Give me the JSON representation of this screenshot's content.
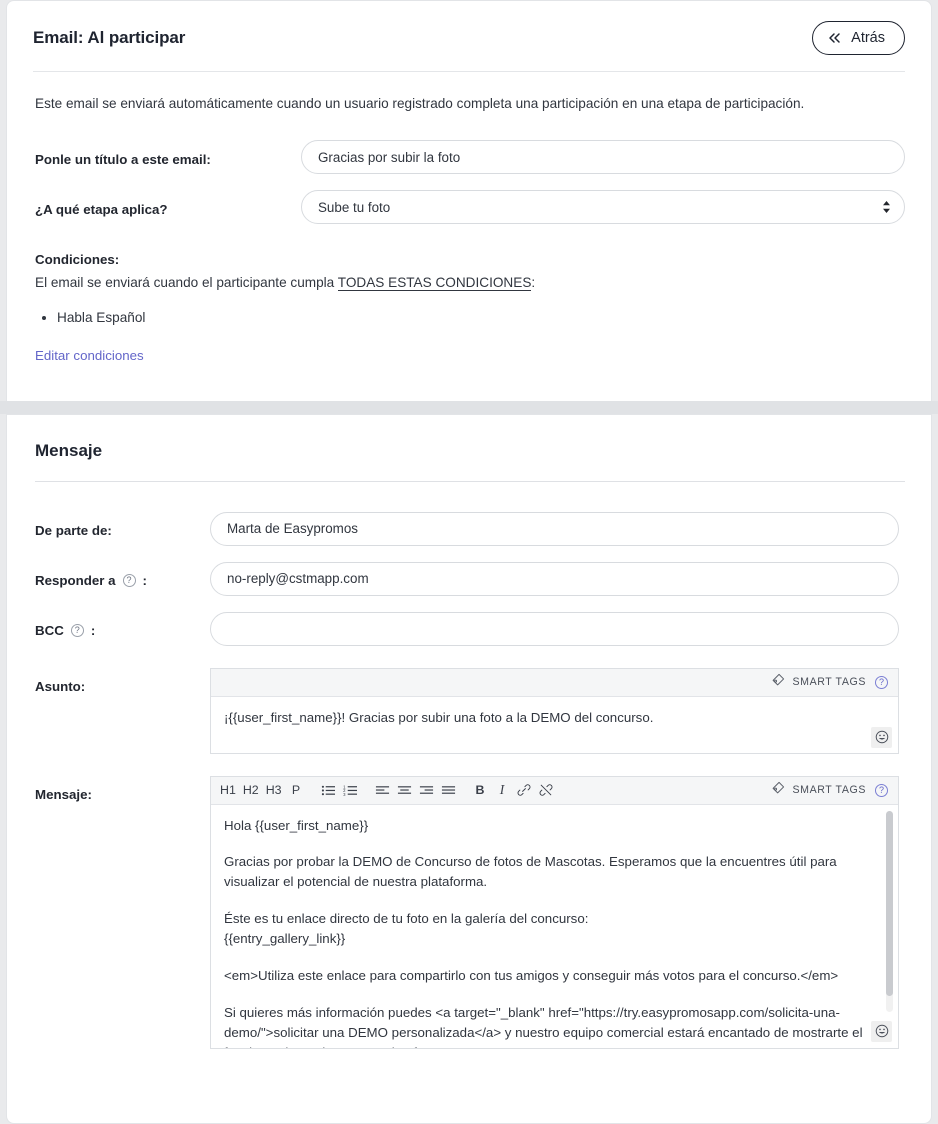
{
  "header": {
    "title": "Email: Al participar",
    "back_label": "Atrás",
    "back_icon": "double-chevron-left-icon"
  },
  "intro": "Este email se enviará automáticamente cuando un usuario registrado completa una participación en una etapa de participación.",
  "form": {
    "title_field": {
      "label": "Ponle un título a este email:",
      "value": "Gracias por subir la foto"
    },
    "stage_field": {
      "label": "¿A qué etapa aplica?",
      "value": "Sube tu foto"
    }
  },
  "conditions": {
    "heading": "Condiciones:",
    "sentence_prefix": "El email se enviará cuando el participante cumpla ",
    "sentence_emphasis": "TODAS ESTAS CONDICIONES",
    "sentence_suffix": ":",
    "items": [
      "Habla Español"
    ],
    "edit_link": "Editar condiciones"
  },
  "message": {
    "section_title": "Mensaje",
    "from": {
      "label": "De parte de:",
      "value": "Marta de Easypromos"
    },
    "reply_to": {
      "label": "Responder a",
      "suffix": ":",
      "value": "no-reply@cstmapp.com",
      "help_icon": "question-circle-icon"
    },
    "bcc": {
      "label": "BCC",
      "suffix": ":",
      "value": "",
      "placeholder": "",
      "help_icon": "question-circle-icon"
    },
    "subject": {
      "label": "Asunto:",
      "smart_tags_label": "SMART TAGS",
      "smart_tags_icon": "tag-icon",
      "help_icon": "question-circle-icon",
      "emoji_icon": "emoji-smile-icon",
      "value": "¡{{user_first_name}}! Gracias por subir una foto a la DEMO del concurso."
    },
    "body": {
      "label": "Mensaje:",
      "smart_tags_label": "SMART TAGS",
      "smart_tags_icon": "tag-icon",
      "help_icon": "question-circle-icon",
      "emoji_icon": "emoji-smile-icon",
      "toolbar": [
        {
          "name": "h1",
          "label": "H1",
          "icon": "heading-1-icon"
        },
        {
          "name": "h2",
          "label": "H2",
          "icon": "heading-2-icon"
        },
        {
          "name": "h3",
          "label": "H3",
          "icon": "heading-3-icon"
        },
        {
          "name": "paragraph",
          "label": "P",
          "icon": "paragraph-icon"
        },
        {
          "name": "bullet-list",
          "label": "",
          "icon": "bullet-list-icon"
        },
        {
          "name": "numbered-list",
          "label": "",
          "icon": "numbered-list-icon"
        },
        {
          "name": "align-left",
          "label": "",
          "icon": "align-left-icon"
        },
        {
          "name": "align-center",
          "label": "",
          "icon": "align-center-icon"
        },
        {
          "name": "align-right",
          "label": "",
          "icon": "align-right-icon"
        },
        {
          "name": "align-justify",
          "label": "",
          "icon": "align-justify-icon"
        },
        {
          "name": "bold",
          "label": "B",
          "icon": "bold-icon"
        },
        {
          "name": "italic",
          "label": "I",
          "icon": "italic-icon"
        },
        {
          "name": "link",
          "label": "",
          "icon": "link-icon"
        },
        {
          "name": "unlink",
          "label": "",
          "icon": "unlink-icon"
        }
      ],
      "paragraphs": [
        "Hola {{user_first_name}}",
        "Gracias por probar la DEMO de Concurso de fotos de Mascotas. Esperamos que la encuentres útil para visualizar el potencial de nuestra plataforma.",
        "Éste es tu enlace directo de tu foto en la galería del concurso:\n{{entry_gallery_link}}",
        "<em>Utiliza este enlace para compartirlo con tus amigos y conseguir más votos para el concurso.</em>",
        "Si quieres más información puedes <a target=\"_blank\" href=\"https://try.easypromosapp.com/solicita-una-demo/\">solicitar una DEMO personalizada</a> y nuestro equipo comercial estará encantado de mostrarte el funcionamiento de nuestra plataforma."
      ]
    }
  },
  "colors": {
    "link": "#6366c9",
    "page_bg": "#e9eaec",
    "panel_bg": "#ffffff",
    "text": "#31363f"
  }
}
